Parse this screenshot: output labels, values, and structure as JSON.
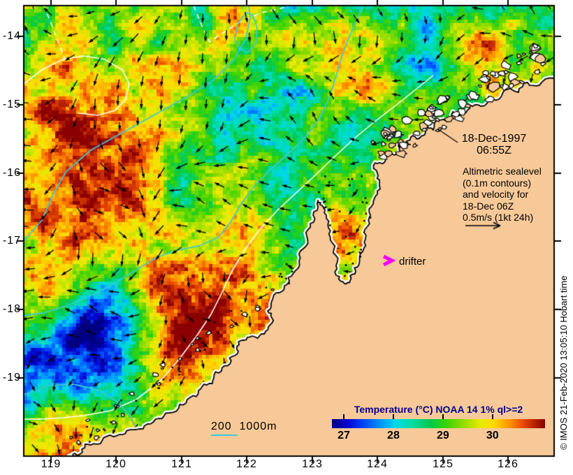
{
  "figure_type": "satellite sea-surface temperature map with altimetric velocity overlay",
  "date_annotation": {
    "line1": "18-Dec-1997",
    "line2": "06:55Z"
  },
  "annotation": {
    "lines": [
      "Altimetric sealevel",
      "(0.1m contours)",
      "and velocity for",
      "18-Dec 06Z",
      "0.5m/s (1kt 24h)"
    ]
  },
  "drifter": {
    "label": "drifter",
    "marker_color": "#F400F4"
  },
  "scale_legend": {
    "label": "200  1000m",
    "line_color": "#3EC9D6"
  },
  "credit": {
    "text": "© IMOS 21-Feb-2020 13:05:10 Hobart time"
  },
  "axes": {
    "x": {
      "tick_labels": [
        "119",
        "120",
        "121",
        "122",
        "123",
        "124",
        "125",
        "126"
      ],
      "range_deg_east": [
        118.58,
        126.71
      ]
    },
    "y": {
      "tick_labels": [
        "-14",
        "-15",
        "-16",
        "-17",
        "-18",
        "-19"
      ],
      "range_deg_north": [
        -13.55,
        -20.15
      ]
    }
  },
  "colorbar": {
    "title": "Temperature (°C) NOAA 14 1% ql>=2",
    "title_color": "#00008B",
    "tick_labels": [
      "27",
      "28",
      "29",
      "30"
    ],
    "ticks": [
      27,
      28,
      29,
      30
    ],
    "range": [
      26.76,
      31.06
    ],
    "gradient_stops": [
      {
        "p": 0.0,
        "c": "#000080"
      },
      {
        "p": 0.07,
        "c": "#0000CD"
      },
      {
        "p": 0.16,
        "c": "#0050FF"
      },
      {
        "p": 0.24,
        "c": "#00A0FF"
      },
      {
        "p": 0.3,
        "c": "#00D8E8"
      },
      {
        "p": 0.38,
        "c": "#00DCA0"
      },
      {
        "p": 0.46,
        "c": "#00C850"
      },
      {
        "p": 0.54,
        "c": "#3CD400"
      },
      {
        "p": 0.62,
        "c": "#96DC00"
      },
      {
        "p": 0.7,
        "c": "#E8EC00"
      },
      {
        "p": 0.76,
        "c": "#FFD800"
      },
      {
        "p": 0.83,
        "c": "#FF9600"
      },
      {
        "p": 0.9,
        "c": "#E64500"
      },
      {
        "p": 1.0,
        "c": "#8B0000"
      }
    ]
  },
  "map_colors": {
    "land": "#F8C998",
    "coastline": "#000000",
    "cloud_mask": "#FFFFFF",
    "bathymetry_contour": "#3EC9D6",
    "sealevel_contour": "#FFFFFF",
    "velocity_vectors": "#000000",
    "background": "#FFFFFF"
  },
  "chart_data": {
    "type": "heatmap",
    "title": "Temperature (°C) NOAA 14 1% ql>=2",
    "value_ticks": [
      27,
      28,
      29,
      30
    ],
    "value_range": [
      26.76,
      31.06
    ],
    "x_ticks_longitude": [
      119,
      120,
      121,
      122,
      123,
      124,
      125,
      126
    ],
    "y_ticks_latitude": [
      -14,
      -15,
      -16,
      -17,
      -18,
      -19
    ],
    "overlays": [
      "0.1m altimetric sealevel contours",
      "velocity vectors 0.5m/s (1kt 24h)",
      "200m and 1000m isobaths",
      "drifter position"
    ]
  }
}
